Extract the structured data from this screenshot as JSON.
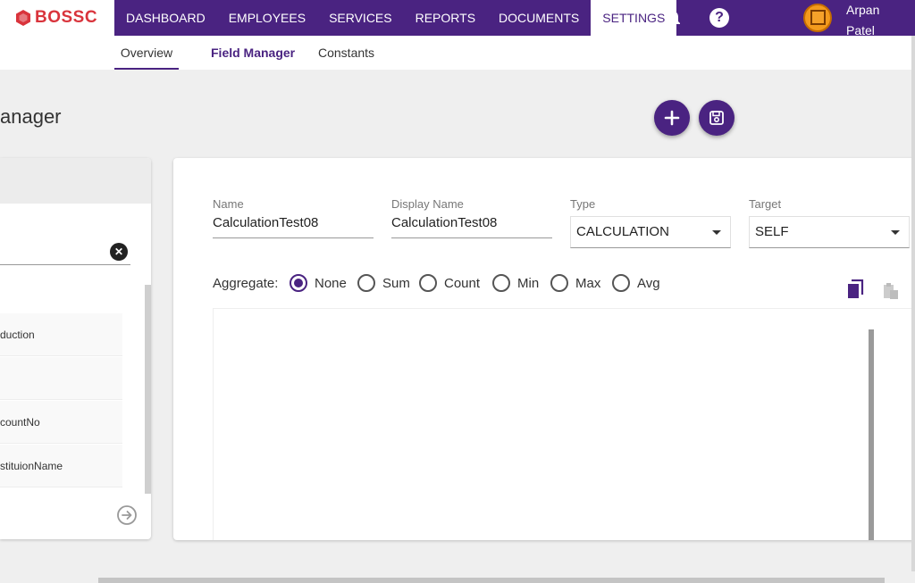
{
  "brand": {
    "logo_text": "BOSSC",
    "color": "#d9343c"
  },
  "theme": {
    "primary": "#4a2381"
  },
  "nav": {
    "items": [
      {
        "label": "DASHBOARD"
      },
      {
        "label": "EMPLOYEES"
      },
      {
        "label": "SERVICES"
      },
      {
        "label": "REPORTS"
      },
      {
        "label": "DOCUMENTS"
      },
      {
        "label": "SETTINGS"
      }
    ],
    "active": "SETTINGS",
    "icons": [
      "bell-icon",
      "help-icon"
    ]
  },
  "user": {
    "first_name": "Arpan",
    "last_name": "Patel"
  },
  "subtabs": {
    "items": [
      {
        "label": "Overview"
      },
      {
        "label": "Field Manager"
      },
      {
        "label": "Constants"
      }
    ],
    "active": "Overview"
  },
  "page": {
    "title": "anager"
  },
  "left_panel": {
    "items": [
      {
        "label": "duction"
      },
      {
        "label": ""
      },
      {
        "label": "countNo"
      },
      {
        "label": "stituionName"
      }
    ]
  },
  "form": {
    "name": {
      "label": "Name",
      "value": "CalculationTest08"
    },
    "display_name": {
      "label": "Display Name",
      "value": "CalculationTest08"
    },
    "type": {
      "label": "Type",
      "value": "CALCULATION"
    },
    "target": {
      "label": "Target",
      "value": "SELF"
    },
    "aggregate": {
      "label": "Aggregate:",
      "options": [
        "None",
        "Sum",
        "Count",
        "Min",
        "Max",
        "Avg"
      ],
      "selected": "None"
    }
  }
}
